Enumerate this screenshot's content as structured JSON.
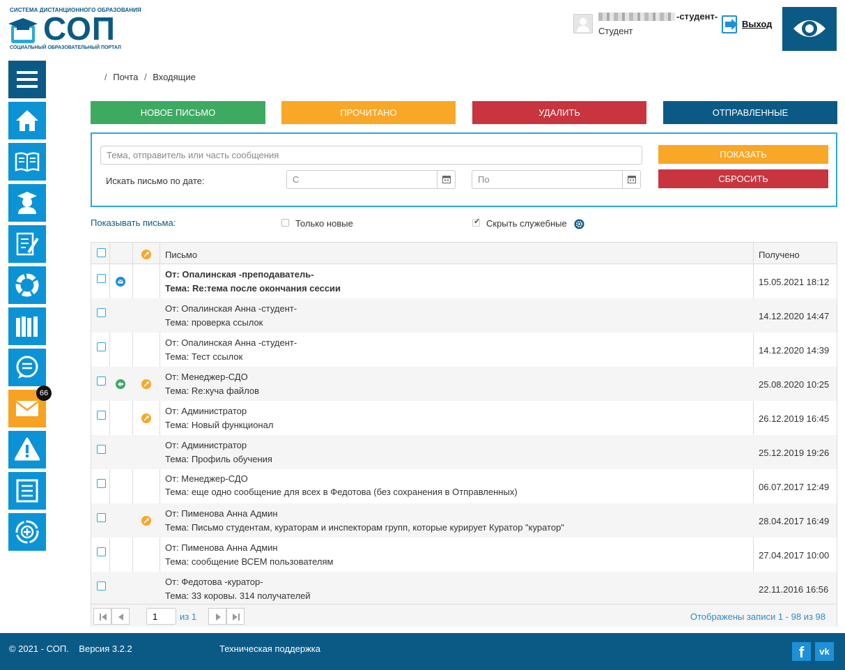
{
  "header": {
    "logo_top": "СИСТЕМА ДИСТАНЦИОННОГО ОБРАЗОВАНИЯ",
    "logo_main": "СОП",
    "logo_bottom": "СОЦИАЛЬНЫЙ ОБРАЗОВАТЕЛЬНЫЙ ПОРТАЛ",
    "user_suffix": "-студент-",
    "user_role": "Студент",
    "logout_label": "Выход"
  },
  "sidebar": {
    "icons": [
      "menu-icon",
      "home-icon",
      "book-icon",
      "graduate-icon",
      "tasks-icon",
      "progress-icon",
      "library-icon",
      "chat-icon",
      "mail-icon",
      "alert-icon",
      "list-icon",
      "add-icon"
    ],
    "mail_badge": "66"
  },
  "breadcrumb": {
    "sep": "/",
    "items": [
      "Почта",
      "Входящие"
    ]
  },
  "actions": {
    "new": "Новое письмо",
    "read": "Прочитано",
    "delete": "Удалить",
    "sent": "Отправленные"
  },
  "search": {
    "placeholder": "Тема, отправитель или часть сообщения",
    "date_label": "Искать письмо по дате:",
    "from_placeholder": "С",
    "to_placeholder": "По",
    "show_label": "Показать",
    "reset_label": "Сбросить"
  },
  "filters": {
    "show_label": "Показывать письма:",
    "only_new": "Только новые",
    "only_new_checked": false,
    "hide_service": "Скрыть служебные",
    "hide_service_checked": true
  },
  "table": {
    "col_letter": "Письмо",
    "col_received": "Получено",
    "rows": [
      {
        "from": "От: Опалинская -преподаватель-",
        "subject": "Тема: Re:тема после окончания сессии",
        "received": "15.05.2021 18:12",
        "unread": true,
        "status_icon": "envelope-icon",
        "pinned": false
      },
      {
        "from": "От: Опалинская Анна -студент-",
        "subject": "Тема: проверка ссылок",
        "received": "14.12.2020 14:47",
        "unread": false,
        "status_icon": "",
        "pinned": false
      },
      {
        "from": "От: Опалинская Анна -студент-",
        "subject": "Тема: Тест ссылок",
        "received": "14.12.2020 14:39",
        "unread": false,
        "status_icon": "",
        "pinned": false
      },
      {
        "from": "От: Менеджер-СДО",
        "subject": "Тема: Re:куча файлов",
        "received": "25.08.2020 10:25",
        "unread": false,
        "status_icon": "reply-icon",
        "pinned": true
      },
      {
        "from": "От: Администратор",
        "subject": "Тема: Новый функционал",
        "received": "26.12.2019 16:45",
        "unread": false,
        "status_icon": "",
        "pinned": true
      },
      {
        "from": "От: Администратор",
        "subject": "Тема: Профиль обучения",
        "received": "25.12.2019 19:26",
        "unread": false,
        "status_icon": "",
        "pinned": false
      },
      {
        "from": "От: Менеджер-СДО",
        "subject": "Тема: еще одно сообщение для всех в Федотова (без сохранения в Отправленных)",
        "received": "06.07.2017 12:49",
        "unread": false,
        "status_icon": "",
        "pinned": false
      },
      {
        "from": "От: Пименова Анна Админ",
        "subject": "Тема: Письмо студентам, кураторам и инспекторам групп, которые курирует Куратор \"куратор\"",
        "received": "28.04.2017 16:49",
        "unread": false,
        "status_icon": "",
        "pinned": true
      },
      {
        "from": "От: Пименова Анна Админ",
        "subject": "Тема: сообщение ВСЕМ пользователям",
        "received": "27.04.2017 10:00",
        "unread": false,
        "status_icon": "",
        "pinned": false
      },
      {
        "from": "От: Федотова -куратор-",
        "subject": "Тема: 33 коровы. 314 получателей",
        "received": "22.11.2016 16:56",
        "unread": false,
        "status_icon": "",
        "pinned": false
      }
    ]
  },
  "pager": {
    "page": "1",
    "of_label": "из 1",
    "summary": "Отображены записи 1 - 98 из 98"
  },
  "footer": {
    "copyright": "© 2021 - СОП.",
    "version": "Версия 3.2.2",
    "support": "Техническая поддержка",
    "fb": "f",
    "vk": "vk"
  },
  "colors": {
    "navy": "#0b5a86",
    "blue": "#0c93d6",
    "green": "#3daa62",
    "orange": "#f9a726",
    "red": "#c9353f"
  }
}
